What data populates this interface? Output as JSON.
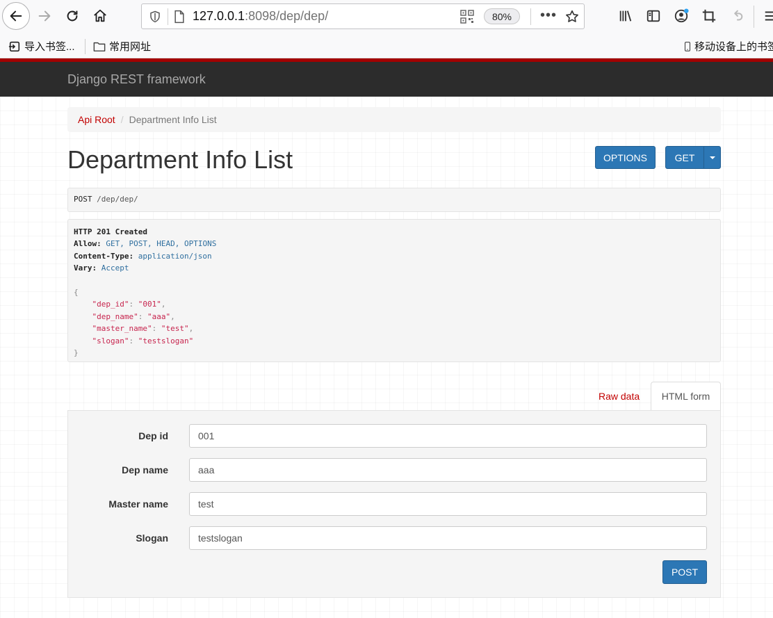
{
  "browser": {
    "url_host": "127.0.0.1",
    "url_rest": ":8098/dep/dep/",
    "zoom": "80%",
    "bookmarks": {
      "import": "导入书签...",
      "common": "常用网址",
      "mobile": "移动设备上的书签"
    }
  },
  "app": {
    "brand": "Django REST framework",
    "breadcrumb": {
      "root": "Api Root",
      "separator": "/",
      "current": "Department Info List"
    },
    "title": "Department Info List",
    "buttons": {
      "options": "OPTIONS",
      "get": "GET",
      "post": "POST"
    },
    "request": {
      "method": "POST",
      "path": "/dep/dep/"
    },
    "response": {
      "status": "HTTP 201 Created",
      "headers": [
        {
          "name": "Allow:",
          "value": "GET, POST, HEAD, OPTIONS"
        },
        {
          "name": "Content-Type:",
          "value": "application/json"
        },
        {
          "name": "Vary:",
          "value": "Accept"
        }
      ],
      "body": [
        {
          "key": "\"dep_id\"",
          "value": "\"001\"",
          "comma": ","
        },
        {
          "key": "\"dep_name\"",
          "value": "\"aaa\"",
          "comma": ","
        },
        {
          "key": "\"master_name\"",
          "value": "\"test\"",
          "comma": ","
        },
        {
          "key": "\"slogan\"",
          "value": "\"testslogan\"",
          "comma": ""
        }
      ],
      "open_brace": "{",
      "close_brace": "}"
    },
    "tabs": {
      "raw": "Raw data",
      "html": "HTML form"
    },
    "form": {
      "fields": [
        {
          "label": "Dep id",
          "value": "001"
        },
        {
          "label": "Dep name",
          "value": "aaa"
        },
        {
          "label": "Master name",
          "value": "test"
        },
        {
          "label": "Slogan",
          "value": "testslogan"
        }
      ]
    }
  }
}
